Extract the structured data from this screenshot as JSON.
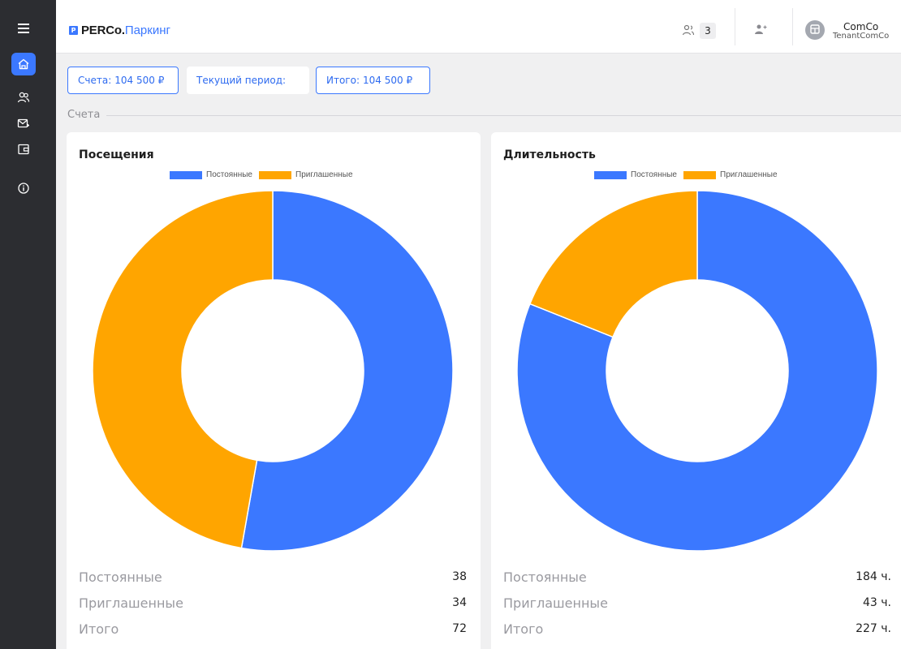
{
  "sidebar": {
    "items": [
      {
        "icon": "menu-icon"
      },
      {
        "icon": "home-icon",
        "active": true
      },
      {
        "icon": "users-icon"
      },
      {
        "icon": "mail-icon"
      },
      {
        "icon": "wallet-icon"
      },
      {
        "icon": "info-icon"
      }
    ]
  },
  "header": {
    "logo_badge": "P",
    "logo_brand": "PERCo.",
    "logo_product": "Паркинг",
    "users_count": "3",
    "company_name": "ComCo",
    "company_sub": "TenantComCo"
  },
  "summary": {
    "accounts_label": "Счета:",
    "accounts_value": "104 500 ₽",
    "period_label": "Текущий период:",
    "total_label": "Итого:",
    "total_value": "104 500 ₽"
  },
  "section_title": "Счета",
  "colors": {
    "permanent": "#3b78ff",
    "invited": "#ffa500",
    "accent": "#3b78ff"
  },
  "chart_data": [
    {
      "type": "pie",
      "title": "Посещения",
      "categories": [
        "Постоянные",
        "Приглашенные"
      ],
      "values": [
        38,
        34
      ],
      "colors": [
        "#3b78ff",
        "#ffa500"
      ],
      "legend": "top"
    },
    {
      "type": "pie",
      "title": "Длительность",
      "categories": [
        "Постоянные",
        "Приглашенные"
      ],
      "values": [
        184,
        43
      ],
      "colors": [
        "#3b78ff",
        "#ffa500"
      ],
      "legend": "top"
    }
  ],
  "cards": [
    {
      "title": "Посещения",
      "rows": [
        {
          "label": "Постоянные",
          "value": "38"
        },
        {
          "label": "Приглашенные",
          "value": "34"
        },
        {
          "label": "Итого",
          "value": "72"
        }
      ]
    },
    {
      "title": "Длительность",
      "rows": [
        {
          "label": "Постоянные",
          "value": "184 ч."
        },
        {
          "label": "Приглашенные",
          "value": "43 ч."
        },
        {
          "label": "Итого",
          "value": "227 ч."
        }
      ]
    }
  ]
}
